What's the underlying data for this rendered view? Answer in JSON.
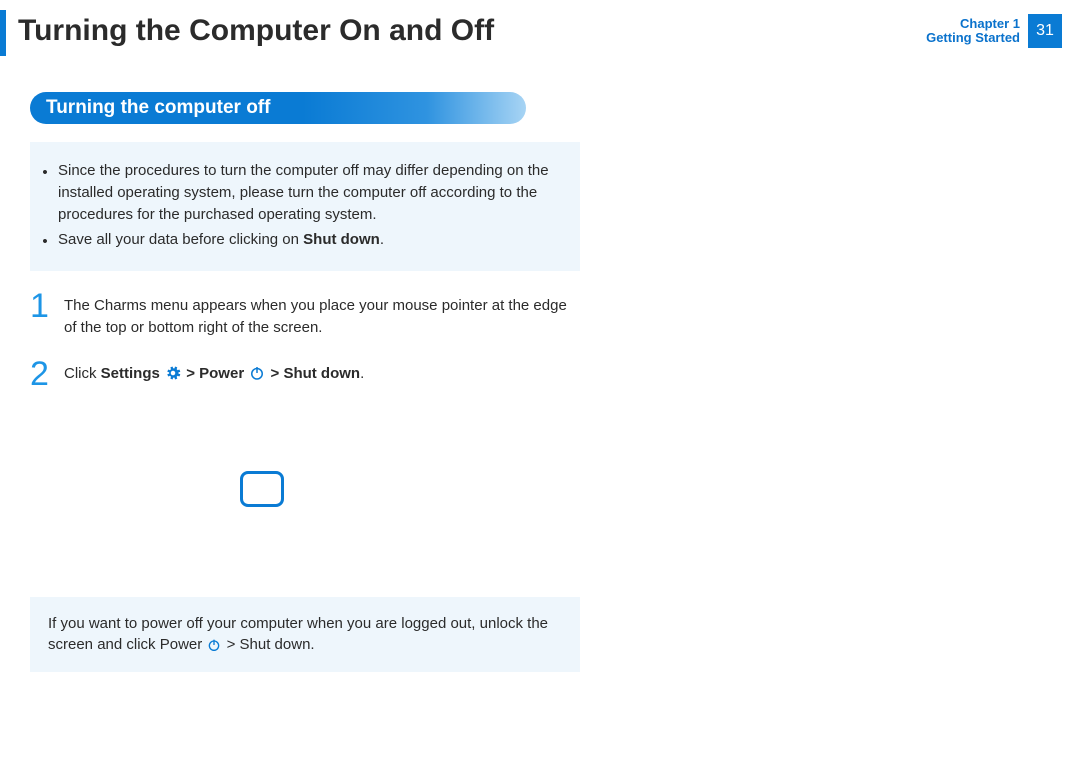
{
  "header": {
    "title": "Turning the Computer On and Off",
    "chapter_line1": "Chapter 1",
    "chapter_line2": "Getting Started",
    "page": "31"
  },
  "section_title": "Turning the computer off",
  "notes": [
    "Since the procedures to turn the computer off may differ depending on the installed operating system, please turn the computer off according to the procedures for the purchased operating system.",
    "Save all your data before clicking on "
  ],
  "notes_bold_tail": "Shut down",
  "steps": [
    {
      "num": "1",
      "text": "The Charms menu appears when you place your mouse pointer at the edge of the top or bottom right of the screen."
    },
    {
      "num": "2",
      "prefix": "Click ",
      "settings": "Settings",
      "sep1": " > ",
      "power": "Power",
      "sep2": " > ",
      "shut": "Shut down",
      "period": "."
    }
  ],
  "footer_note": {
    "line1a": "If you want to power off your computer when you are logged out, unlock the screen and click ",
    "power": "Power",
    "sep": " > ",
    "shut": "Shut down",
    "period": "."
  }
}
